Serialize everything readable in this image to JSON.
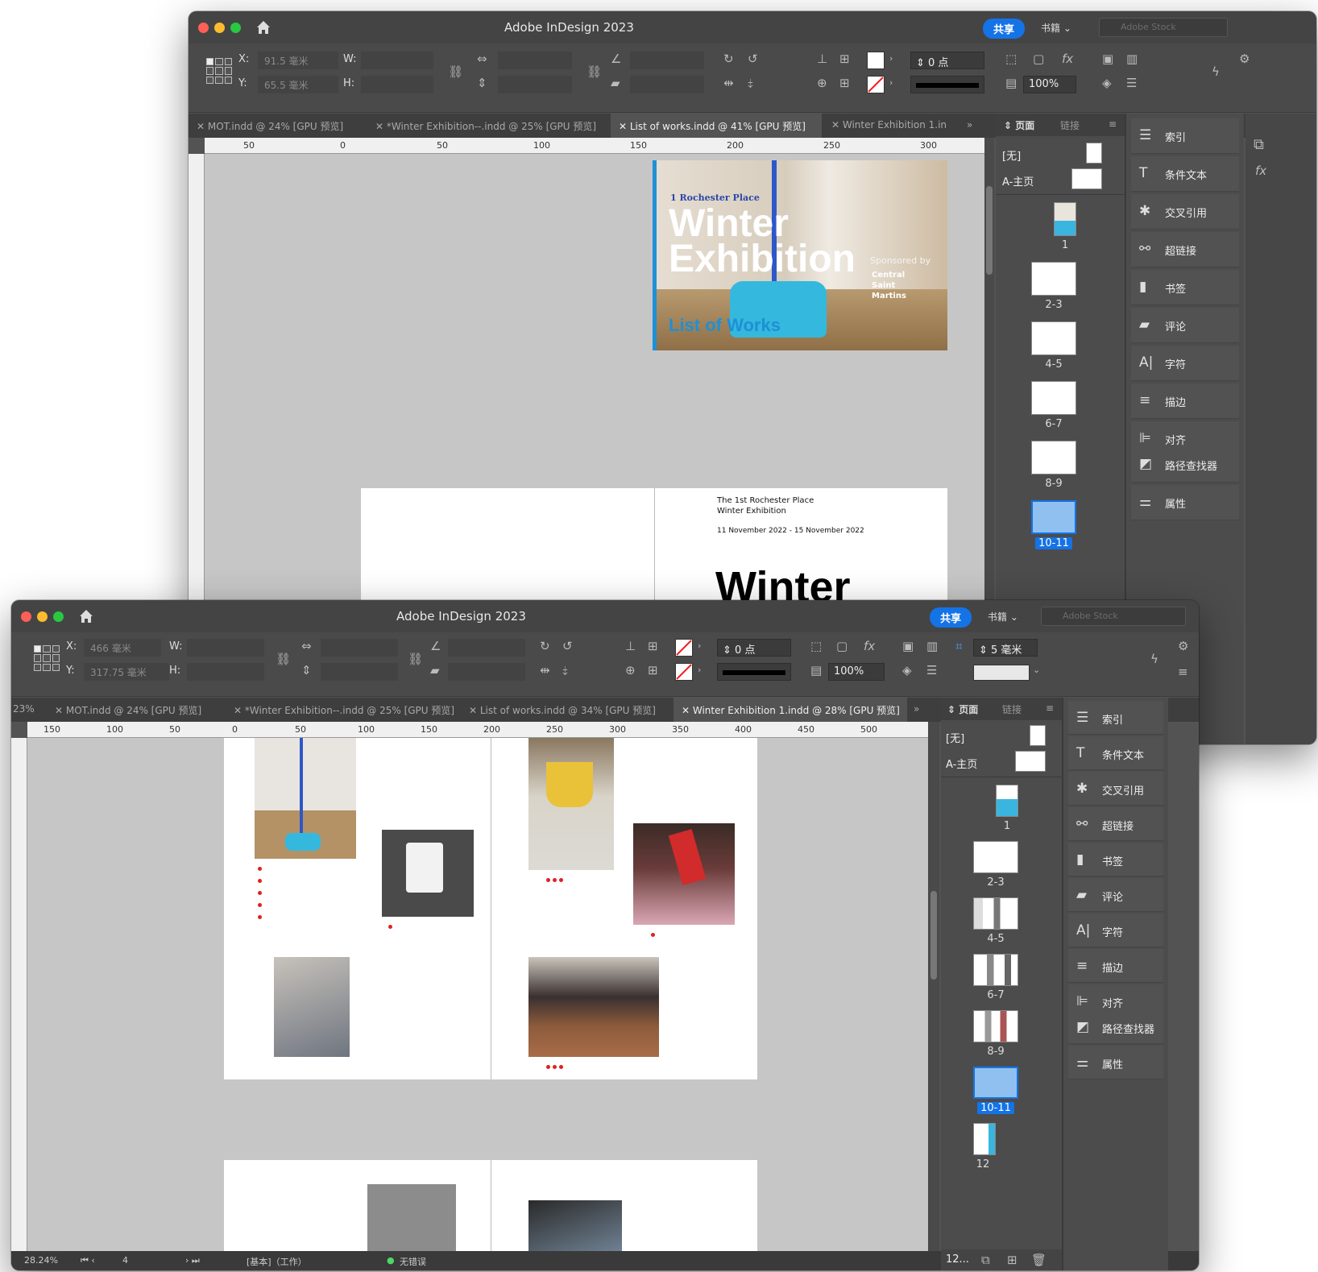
{
  "back_window": {
    "title": "Adobe InDesign 2023",
    "share_label": "共享",
    "books_label": "书籍",
    "stock_placeholder": "Adobe Stock",
    "x_label": "X:",
    "x_value": "91.5 毫米",
    "y_label": "Y:",
    "y_value": "65.5 毫米",
    "w_label": "W:",
    "h_label": "H:",
    "stroke_weight": "0 点",
    "opacity": "100%",
    "tabs": [
      "MOT.indd @ 24% [GPU 预览]",
      "*Winter Exhibition--.indd @ 25% [GPU 预览]",
      "List of works.indd @ 41% [GPU 预览]",
      "Winter Exhibition 1.in"
    ],
    "ruler_ticks": [
      "50",
      "0",
      "50",
      "100",
      "150",
      "200",
      "250",
      "300"
    ],
    "cover": {
      "place": "1 Rochester Place",
      "title_line1": "Winter",
      "title_line2": "Exhibition",
      "sponsor": "Sponsored by",
      "sponsor_name": "Central Saint Martins",
      "list": "List of Works"
    },
    "spread": {
      "line1": "The 1st Rochester Place",
      "line2": "Winter Exhibition",
      "dates": "11 November 2022 - 15 November 2022",
      "heading": "Winter"
    },
    "pages_panel": {
      "tab_pages": "页面",
      "tab_links": "链接",
      "none_master": "[无]",
      "a_master": "A-主页",
      "thumbs": [
        "1",
        "2-3",
        "4-5",
        "6-7",
        "8-9",
        "10-11"
      ],
      "selected": "10-11"
    }
  },
  "side_panels": [
    "索引",
    "条件文本",
    "交叉引用",
    "超链接",
    "书签",
    "评论",
    "字符",
    "描边",
    "对齐",
    "路径查找器",
    "属性"
  ],
  "front_window": {
    "title": "Adobe InDesign 2023",
    "share_label": "共享",
    "books_label": "书籍",
    "stock_placeholder": "Adobe Stock",
    "x_label": "X:",
    "x_value": "466 毫米",
    "y_label": "Y:",
    "y_value": "317.75 毫米",
    "w_label": "W:",
    "h_label": "H:",
    "stroke_weight": "0 点",
    "opacity": "100%",
    "gap": "5 毫米",
    "zoom_tab": "23%",
    "tabs": [
      "MOT.indd @ 24% [GPU 预览]",
      "*Winter Exhibition--.indd @ 25% [GPU 预览]",
      "List of works.indd @ 34% [GPU 预览]",
      "Winter Exhibition 1.indd @ 28% [GPU 预览]"
    ],
    "ruler_ticks": [
      "150",
      "100",
      "50",
      "0",
      "50",
      "100",
      "150",
      "200",
      "250",
      "300",
      "350",
      "400",
      "450",
      "500"
    ],
    "pages_panel": {
      "tab_pages": "页面",
      "tab_links": "链接",
      "none_master": "[无]",
      "a_master": "A-主页",
      "thumbs": [
        "1",
        "2-3",
        "4-5",
        "6-7",
        "8-9",
        "10-11",
        "12"
      ],
      "selected": "10-11",
      "footer_count": "12..."
    },
    "status": {
      "zoom": "28.24%",
      "page": "4",
      "profile": "[基本]（工作）",
      "preflight": "无错误"
    }
  },
  "colors": {
    "accent": "#1473e6",
    "ui_bg": "#535353",
    "pasteboard": "#c6c6c6",
    "cover_blue": "#1e90d6"
  }
}
